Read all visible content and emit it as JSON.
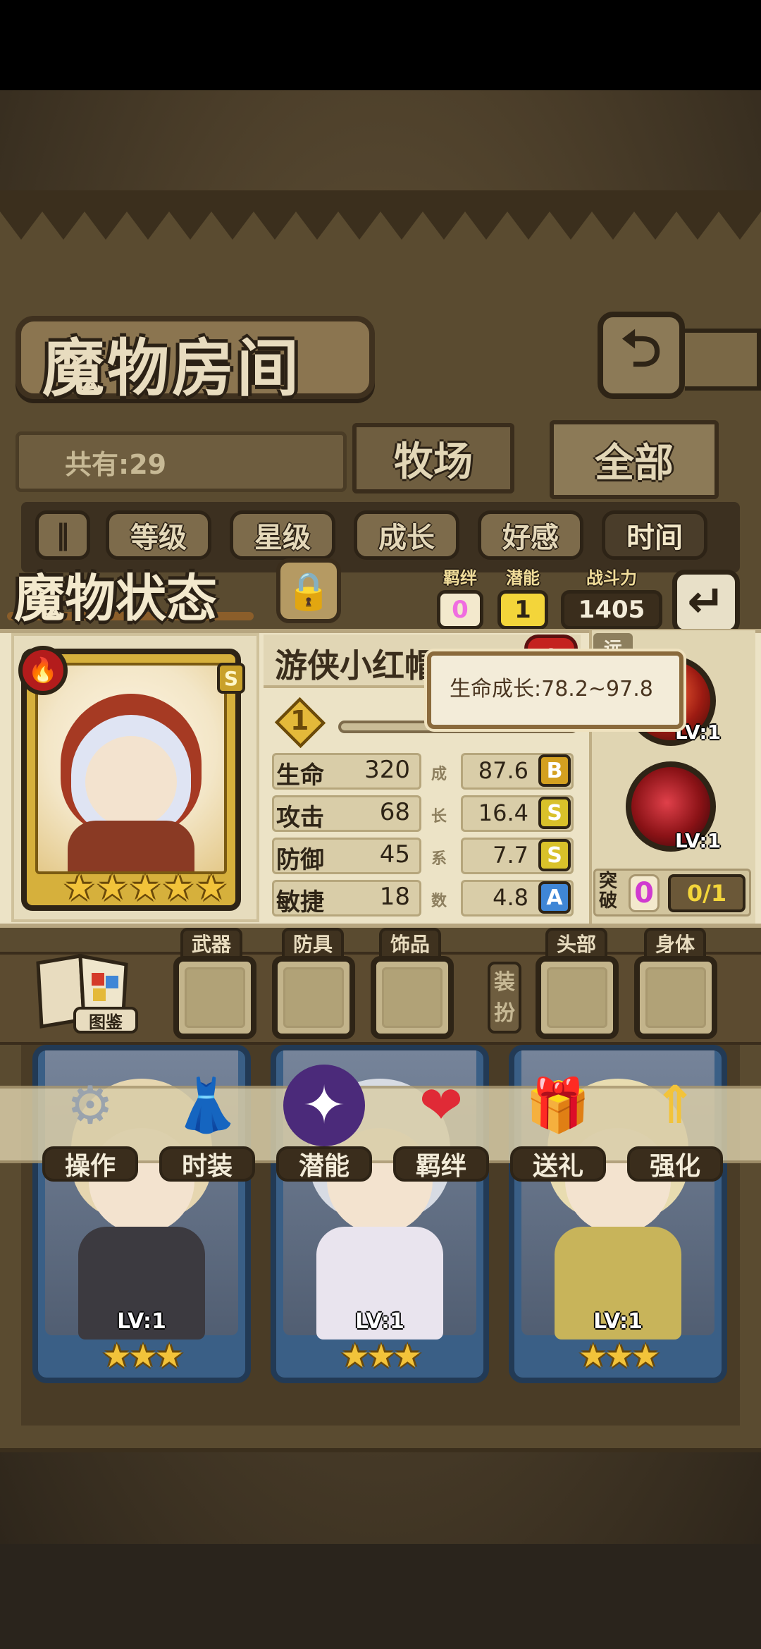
{
  "room": {
    "title": "魔物房间",
    "count_text": "共有:29",
    "tabs": [
      "牧场",
      "全部"
    ]
  },
  "sort": {
    "toggle_icon": "‖",
    "buttons": [
      "等级",
      "星级",
      "成长",
      "好感",
      "时间"
    ],
    "active": "时间"
  },
  "status": {
    "title": "魔物状态",
    "bond_label": "羁绊",
    "bond_value": "0",
    "potential_label": "潜能",
    "potential_value": "1",
    "power_label": "战斗力",
    "power_value": "1405",
    "hero_name": "游侠小红帽",
    "bond_heart_value": "0",
    "star_level": "1",
    "rank": "S",
    "element_icon": "fire-icon",
    "range_tag": "远",
    "tooltip": "生命成长:78.2~97.8",
    "stats": [
      {
        "label": "生命",
        "value": "320",
        "growth": "87.6",
        "grade": "B",
        "grade_color": "#d4a020"
      },
      {
        "label": "攻击",
        "value": "68",
        "growth": "16.4",
        "grade": "S",
        "grade_color": "#d9c12a"
      },
      {
        "label": "防御",
        "value": "45",
        "growth": "7.7",
        "grade": "S",
        "grade_color": "#d9c12a"
      },
      {
        "label": "敏捷",
        "value": "18",
        "growth": "4.8",
        "grade": "A",
        "grade_color": "#3f86d6"
      }
    ],
    "growth_vertical_label": [
      "成",
      "长",
      "系",
      "数"
    ],
    "skills": [
      {
        "level": "LV:1"
      },
      {
        "level": "LV:1"
      }
    ],
    "breakthrough_label": "突破",
    "breakthrough_value": "0",
    "breakthrough_progress": "0/1",
    "stars": 5
  },
  "equipment": {
    "book_label": "图鉴",
    "slots": [
      "武器",
      "防具",
      "饰品",
      "头部",
      "身体"
    ],
    "dress_label": "装扮"
  },
  "actions": [
    {
      "label": "操作",
      "icon": "gear-icon",
      "glyph": "⚙"
    },
    {
      "label": "时装",
      "icon": "outfit-icon",
      "glyph": "👗"
    },
    {
      "label": "潜能",
      "icon": "potential-icon",
      "glyph": "✦"
    },
    {
      "label": "羁绊",
      "icon": "heart-icon",
      "glyph": "❤"
    },
    {
      "label": "送礼",
      "icon": "gift-icon",
      "glyph": "🎁"
    },
    {
      "label": "强化",
      "icon": "upgrade-arrows-icon",
      "glyph": "⇑"
    }
  ],
  "roster": [
    {
      "level": "LV:1",
      "stars": 3
    },
    {
      "level": "LV:1",
      "stars": 3
    },
    {
      "level": "LV:1",
      "stars": 3
    }
  ],
  "colors": {
    "panel": "#ece3c6",
    "accent_gold": "#d6b03c",
    "bond_pink": "#d03bd0",
    "power_gold": "#f3d53a"
  }
}
